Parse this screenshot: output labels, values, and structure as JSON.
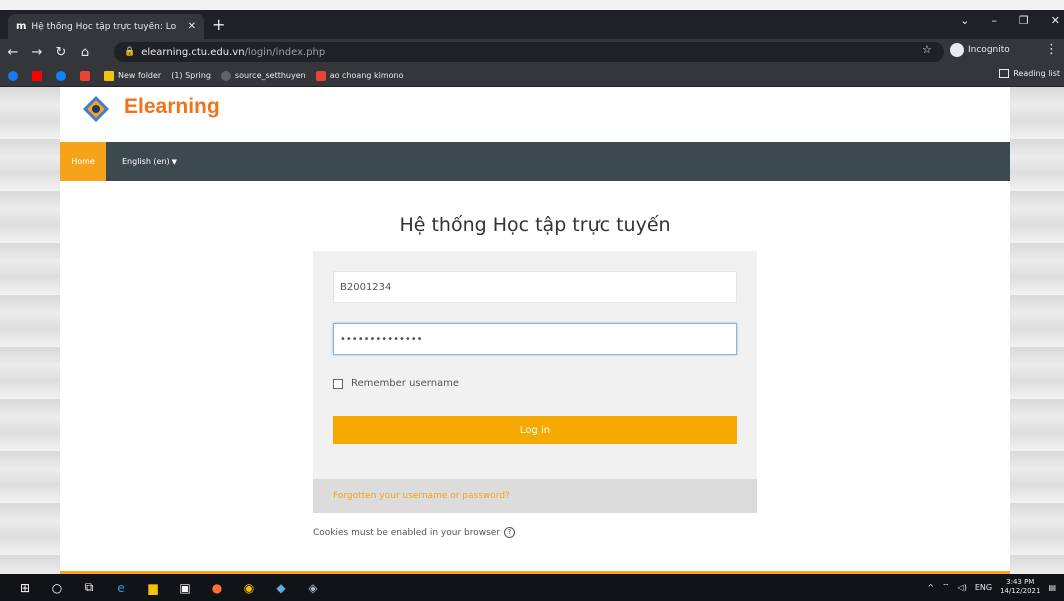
{
  "browser": {
    "tab_title": "Hệ thống Học tập trực tuyến: Lo",
    "tab_favicon": "m",
    "url_host": "elearning.ctu.edu.vn",
    "url_path": "/login/index.php",
    "incognito_label": "Incognito",
    "reading_list_label": "Reading list",
    "bookmarks": [
      {
        "label": "New folder",
        "color": "#f4c20d"
      },
      {
        "label": "(1) Spring",
        "color": "#9aa0a6"
      },
      {
        "label": "source_setthuyen",
        "color": "#5f6368"
      },
      {
        "label": "ao choang kimono",
        "color": "#ea4335"
      }
    ]
  },
  "site": {
    "logo_text": "Elearning",
    "nav": {
      "home": "Home",
      "language": "English (en)"
    },
    "heading": "Hệ thống Học tập trực tuyến",
    "login": {
      "username_value": "B2001234",
      "password_value": "••••••••••••••",
      "remember_label": "Remember username",
      "login_button": "Log in",
      "forgot_link": "Forgotten your username or password?"
    },
    "cookie_note": "Cookies must be enabled in your browser"
  },
  "taskbar": {
    "tray_lang": "ENG",
    "time": "3:43 PM",
    "date": "14/12/2021"
  },
  "colors": {
    "accent": "#f6a21b",
    "navbar": "#3c4a50",
    "logo": "#f0731c"
  }
}
